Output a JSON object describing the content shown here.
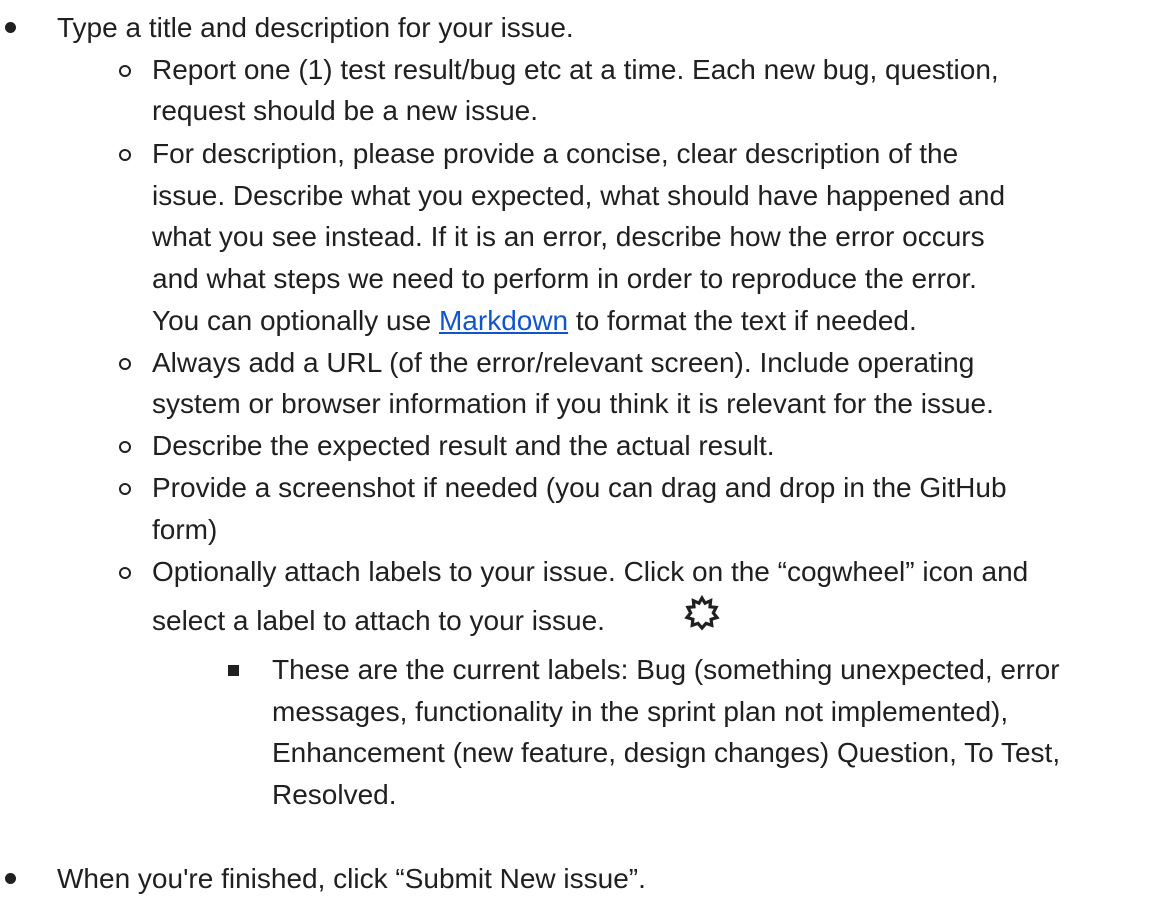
{
  "items": [
    {
      "text": "Type a title and description for your issue.",
      "children": [
        {
          "lines": [
            "Report one (1) test result/bug etc at a time. Each new bug, question,",
            "request should be a new issue."
          ]
        },
        {
          "lines": [
            "For description, please provide a concise, clear description of the",
            "issue. Describe what you expected, what should have happened and",
            "what you see instead. If it is an error, describe how the error occurs",
            "and what steps we need to perform in order to reproduce the error."
          ],
          "last_line_before_link": "You can optionally use ",
          "link_text": "Markdown",
          "last_line_after_link": " to format the text if needed."
        },
        {
          "lines": [
            "Always add a URL (of the error/relevant screen). Include operating",
            "system or browser information if you think it is relevant for the issue."
          ]
        },
        {
          "lines": [
            "Describe the expected result and the actual result."
          ]
        },
        {
          "lines": [
            "Provide a screenshot if needed (you can drag and drop in the GitHub",
            "form)"
          ]
        },
        {
          "lines": [
            "Optionally attach labels to your issue. Click on the “cogwheel” icon and",
            "select a label to attach to your issue."
          ],
          "icon": "gear-icon",
          "children": [
            {
              "lines": [
                "These are the current labels: Bug (something unexpected, error",
                "messages, functionality in the sprint plan not implemented),",
                "Enhancement (new feature, design changes) Question, To Test,",
                "Resolved."
              ]
            }
          ]
        }
      ]
    },
    {
      "text": "When you're finished, click “Submit New issue”."
    }
  ],
  "colors": {
    "text": "#202020",
    "link": "#1155cc"
  }
}
